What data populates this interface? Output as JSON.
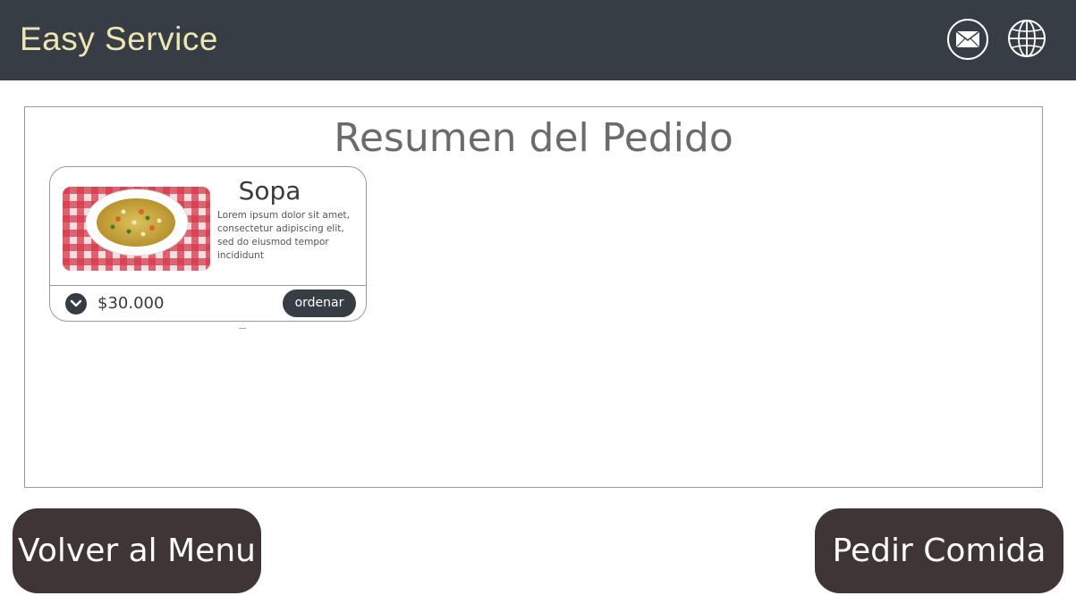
{
  "header": {
    "brand": "Easy Service",
    "icons": [
      "mail-icon",
      "globe-icon"
    ],
    "background": "#363d45",
    "brand_color": "#eee5b3"
  },
  "panel": {
    "title": "Resumen del Pedido",
    "items": [
      {
        "name": "Sopa",
        "description": "Lorem ipsum dolor sit amet, consectetur adipiscing elit, sed do eiusmod tempor incididunt",
        "price": "$30.000",
        "order_label": "ordenar",
        "image": "soup-bowl-image"
      }
    ]
  },
  "footer": {
    "back_label": "Volver al Menu",
    "order_label": "Pedir Comida",
    "button_color": "#403535"
  }
}
